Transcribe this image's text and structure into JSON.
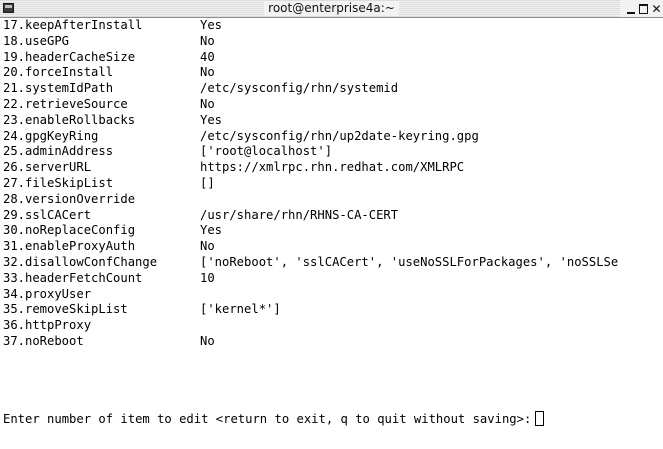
{
  "window": {
    "title": "root@enterprise4a:~",
    "controls": {
      "minimize": "",
      "maximize": "",
      "close": "✕"
    }
  },
  "rows": [
    {
      "num": "17.",
      "key": "keepAfterInstall",
      "value": "Yes"
    },
    {
      "num": "18.",
      "key": "useGPG",
      "value": "No"
    },
    {
      "num": "19.",
      "key": "headerCacheSize",
      "value": "40"
    },
    {
      "num": "20.",
      "key": "forceInstall",
      "value": "No"
    },
    {
      "num": "21.",
      "key": "systemIdPath",
      "value": "/etc/sysconfig/rhn/systemid"
    },
    {
      "num": "22.",
      "key": "retrieveSource",
      "value": "No"
    },
    {
      "num": "23.",
      "key": "enableRollbacks",
      "value": "Yes"
    },
    {
      "num": "24.",
      "key": "gpgKeyRing",
      "value": "/etc/sysconfig/rhn/up2date-keyring.gpg"
    },
    {
      "num": "25.",
      "key": "adminAddress",
      "value": "['root@localhost']"
    },
    {
      "num": "26.",
      "key": "serverURL",
      "value": "https://xmlrpc.rhn.redhat.com/XMLRPC"
    },
    {
      "num": "27.",
      "key": "fileSkipList",
      "value": "[]"
    },
    {
      "num": "28.",
      "key": "versionOverride",
      "value": ""
    },
    {
      "num": "29.",
      "key": "sslCACert",
      "value": "/usr/share/rhn/RHNS-CA-CERT"
    },
    {
      "num": "30.",
      "key": "noReplaceConfig",
      "value": "Yes"
    },
    {
      "num": "31.",
      "key": "enableProxyAuth",
      "value": "No"
    },
    {
      "num": "32.",
      "key": "disallowConfChange",
      "value": "['noReboot', 'sslCACert', 'useNoSSLForPackages', 'noSSLSe"
    },
    {
      "num": "33.",
      "key": "headerFetchCount",
      "value": "10"
    },
    {
      "num": "34.",
      "key": "proxyUser",
      "value": ""
    },
    {
      "num": "35.",
      "key": "removeSkipList",
      "value": "['kernel*']"
    },
    {
      "num": "36.",
      "key": "httpProxy",
      "value": ""
    },
    {
      "num": "37.",
      "key": "noReboot",
      "value": "No"
    }
  ],
  "prompt": "Enter number of item to edit <return to exit, q to quit without saving>:"
}
